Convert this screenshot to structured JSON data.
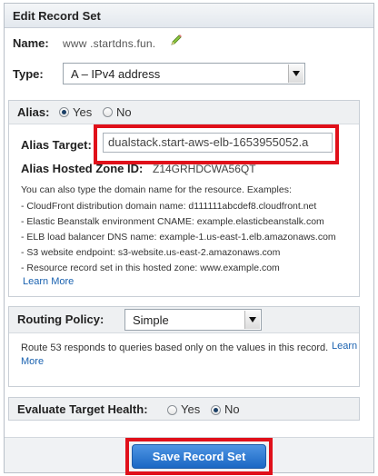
{
  "panel": {
    "title": "Edit Record Set"
  },
  "name": {
    "label": "Name:",
    "value": "www .startdns.fun."
  },
  "type": {
    "label": "Type:",
    "selected": "A – IPv4 address"
  },
  "alias": {
    "label": "Alias:",
    "yes_label": "Yes",
    "no_label": "No",
    "target_label": "Alias Target:",
    "target_value": "dualstack.start-aws-elb-1653955052.a",
    "hosted_zone_label": "Alias Hosted Zone ID:",
    "hosted_zone_value": "Z14GRHDCWA56QT",
    "hints": [
      "You can also type the domain name for the resource. Examples:",
      "-  CloudFront distribution domain name: d111111abcdef8.cloudfront.net",
      "-  Elastic Beanstalk environment CNAME: example.elasticbeanstalk.com",
      "-  ELB load balancer DNS name: example-1.us-east-1.elb.amazonaws.com",
      "-  S3 website endpoint: s3-website.us-east-2.amazonaws.com",
      "-  Resource record set in this hosted zone: www.example.com"
    ],
    "learn_more": "Learn More"
  },
  "routing": {
    "label": "Routing Policy:",
    "selected": "Simple",
    "description": "Route 53 responds to queries based only on the values in this record.",
    "learn_more_part1": "Learn",
    "learn_more_part2": "More"
  },
  "health": {
    "label": "Evaluate Target Health:",
    "yes_label": "Yes",
    "no_label": "No"
  },
  "footer": {
    "save_label": "Save Record Set"
  },
  "colors": {
    "highlight": "#e0101a",
    "button": "#1b67c4",
    "link": "#1a62b0"
  }
}
